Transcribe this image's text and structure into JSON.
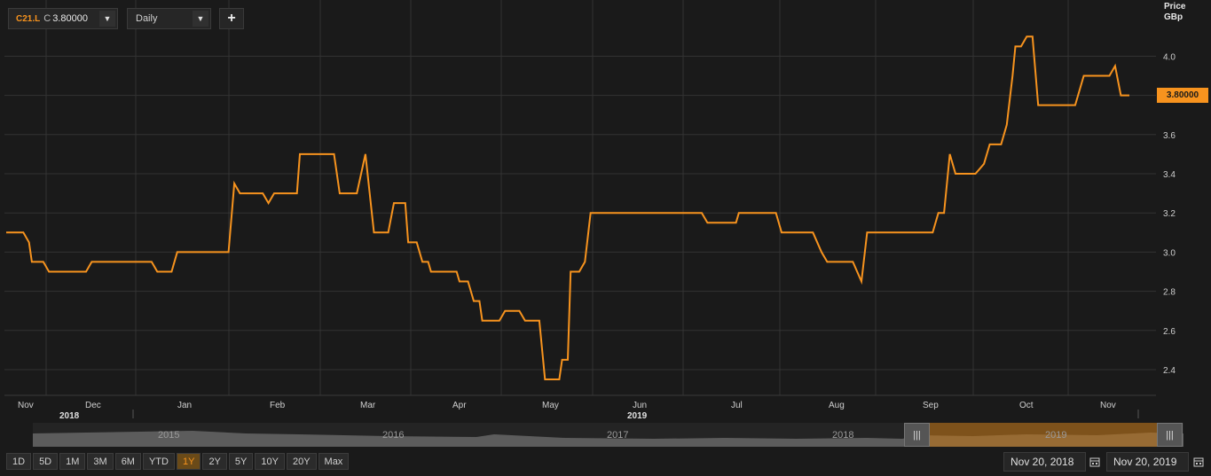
{
  "toolbar": {
    "ric": "C21.L",
    "close_prefix": "C",
    "close_value": "3.80000",
    "interval": "Daily",
    "add_label": "+"
  },
  "axis": {
    "title_line1": "Price",
    "title_line2": "GBp"
  },
  "last_price_badge": "3.80000",
  "colors": {
    "series": "#f7931e",
    "background": "#1a1a1a",
    "grid": "#333333"
  },
  "chart_data": {
    "type": "line",
    "title": "",
    "xlabel": "",
    "ylabel": "Price GBp",
    "ylim": [
      2.3,
      4.2
    ],
    "y_ticks": [
      "2.4",
      "2.6",
      "2.8",
      "3.0",
      "3.2",
      "3.4",
      "3.6",
      "3.8",
      "4.0"
    ],
    "x_ticks": [
      "Nov",
      "Dec",
      "Jan",
      "Feb",
      "Mar",
      "Apr",
      "May",
      "Jun",
      "Jul",
      "Aug",
      "Sep",
      "Oct",
      "Nov"
    ],
    "year_labels": [
      "2018",
      "2019"
    ],
    "grid": true,
    "series": [
      {
        "points": [
          [
            "2018-11-20",
            3.1
          ],
          [
            "2018-11-26",
            3.1
          ],
          [
            "2018-11-28",
            3.05
          ],
          [
            "2018-11-29",
            2.95
          ],
          [
            "2018-12-03",
            2.95
          ],
          [
            "2018-12-05",
            2.9
          ],
          [
            "2018-12-18",
            2.9
          ],
          [
            "2018-12-20",
            2.95
          ],
          [
            "2019-01-10",
            2.95
          ],
          [
            "2019-01-12",
            2.9
          ],
          [
            "2019-01-17",
            2.9
          ],
          [
            "2019-01-19",
            3.0
          ],
          [
            "2019-02-06",
            3.0
          ],
          [
            "2019-02-08",
            3.35
          ],
          [
            "2019-02-10",
            3.3
          ],
          [
            "2019-02-18",
            3.3
          ],
          [
            "2019-02-20",
            3.25
          ],
          [
            "2019-02-22",
            3.3
          ],
          [
            "2019-03-02",
            3.3
          ],
          [
            "2019-03-03",
            3.5
          ],
          [
            "2019-03-15",
            3.5
          ],
          [
            "2019-03-17",
            3.3
          ],
          [
            "2019-03-23",
            3.3
          ],
          [
            "2019-03-26",
            3.5
          ],
          [
            "2019-03-29",
            3.1
          ],
          [
            "2019-04-03",
            3.1
          ],
          [
            "2019-04-05",
            3.25
          ],
          [
            "2019-04-09",
            3.25
          ],
          [
            "2019-04-10",
            3.05
          ],
          [
            "2019-04-13",
            3.05
          ],
          [
            "2019-04-15",
            2.95
          ],
          [
            "2019-04-17",
            2.95
          ],
          [
            "2019-04-18",
            2.9
          ],
          [
            "2019-04-27",
            2.9
          ],
          [
            "2019-04-28",
            2.85
          ],
          [
            "2019-05-01",
            2.85
          ],
          [
            "2019-05-03",
            2.75
          ],
          [
            "2019-05-05",
            2.75
          ],
          [
            "2019-05-06",
            2.65
          ],
          [
            "2019-05-12",
            2.65
          ],
          [
            "2019-05-14",
            2.7
          ],
          [
            "2019-05-19",
            2.7
          ],
          [
            "2019-05-21",
            2.65
          ],
          [
            "2019-05-26",
            2.65
          ],
          [
            "2019-05-28",
            2.35
          ],
          [
            "2019-06-02",
            2.35
          ],
          [
            "2019-06-03",
            2.45
          ],
          [
            "2019-06-05",
            2.45
          ],
          [
            "2019-06-06",
            2.9
          ],
          [
            "2019-06-09",
            2.9
          ],
          [
            "2019-06-11",
            2.95
          ],
          [
            "2019-06-13",
            3.2
          ],
          [
            "2019-07-22",
            3.2
          ],
          [
            "2019-07-24",
            3.15
          ],
          [
            "2019-08-03",
            3.15
          ],
          [
            "2019-08-04",
            3.2
          ],
          [
            "2019-08-17",
            3.2
          ],
          [
            "2019-08-19",
            3.1
          ],
          [
            "2019-08-30",
            3.1
          ],
          [
            "2019-09-02",
            3.0
          ],
          [
            "2019-09-04",
            2.95
          ],
          [
            "2019-09-13",
            2.95
          ],
          [
            "2019-09-16",
            2.85
          ],
          [
            "2019-09-18",
            3.1
          ],
          [
            "2019-10-11",
            3.1
          ],
          [
            "2019-10-13",
            3.2
          ],
          [
            "2019-10-15",
            3.2
          ],
          [
            "2019-10-17",
            3.5
          ],
          [
            "2019-10-19",
            3.4
          ],
          [
            "2019-10-26",
            3.4
          ],
          [
            "2019-10-29",
            3.45
          ],
          [
            "2019-10-31",
            3.55
          ],
          [
            "2019-11-04",
            3.55
          ],
          [
            "2019-11-06",
            3.65
          ],
          [
            "2019-11-08",
            3.9
          ],
          [
            "2019-11-09",
            4.05
          ],
          [
            "2019-11-11",
            4.05
          ],
          [
            "2019-11-13",
            4.1
          ],
          [
            "2019-11-15",
            4.1
          ],
          [
            "2019-11-17",
            3.75
          ],
          [
            "2019-11-30",
            3.75
          ],
          [
            "2019-12-03",
            3.9
          ],
          [
            "2019-12-12",
            3.9
          ],
          [
            "2019-12-14",
            3.95
          ],
          [
            "2019-12-16",
            3.8
          ],
          [
            "2019-12-19",
            3.8
          ]
        ]
      }
    ]
  },
  "navigator": {
    "years": [
      "2015",
      "2016",
      "2017",
      "2018",
      "2019"
    ],
    "handle_left": "|||",
    "handle_right": "|||"
  },
  "range_buttons": [
    "1D",
    "5D",
    "1M",
    "3M",
    "6M",
    "YTD",
    "1Y",
    "2Y",
    "5Y",
    "10Y",
    "20Y",
    "Max"
  ],
  "active_range": "1Y",
  "date_from": "Nov 20, 2018",
  "date_to": "Nov 20, 2019"
}
